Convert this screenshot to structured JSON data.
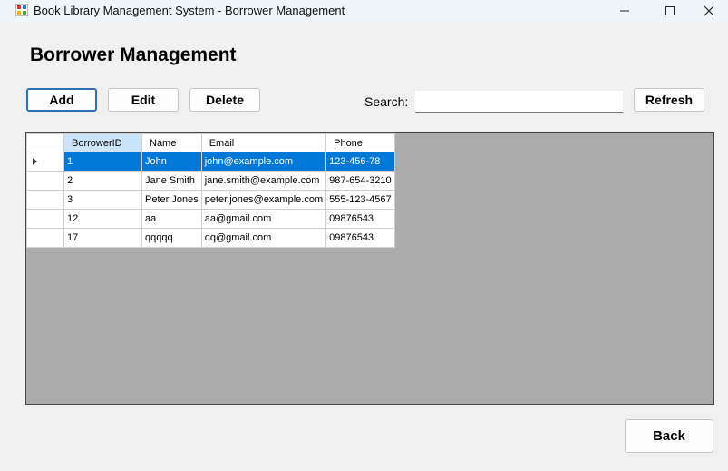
{
  "window": {
    "title": "Book Library Management System - Borrower Management"
  },
  "page": {
    "heading": "Borrower Management"
  },
  "toolbar": {
    "add_label": "Add",
    "edit_label": "Edit",
    "delete_label": "Delete",
    "search_label": "Search:",
    "search_value": "",
    "refresh_label": "Refresh"
  },
  "table": {
    "columns": [
      "BorrowerID",
      "Name",
      "Email",
      "Phone"
    ],
    "selected_row": 0,
    "rows": [
      [
        "1",
        "John",
        "john@example.com",
        "123-456-78"
      ],
      [
        "2",
        "Jane Smith",
        "jane.smith@example.com",
        "987-654-3210"
      ],
      [
        "3",
        "Peter Jones",
        "peter.jones@example.com",
        "555-123-4567"
      ],
      [
        "12",
        "aa",
        "aa@gmail.com",
        "09876543"
      ],
      [
        "17",
        "qqqqq",
        "qq@gmail.com",
        "09876543"
      ]
    ]
  },
  "footer": {
    "back_label": "Back"
  },
  "colors": {
    "selection": "#0078d7",
    "header_sorted": "#cce4f7",
    "grid_background": "#ababab"
  }
}
